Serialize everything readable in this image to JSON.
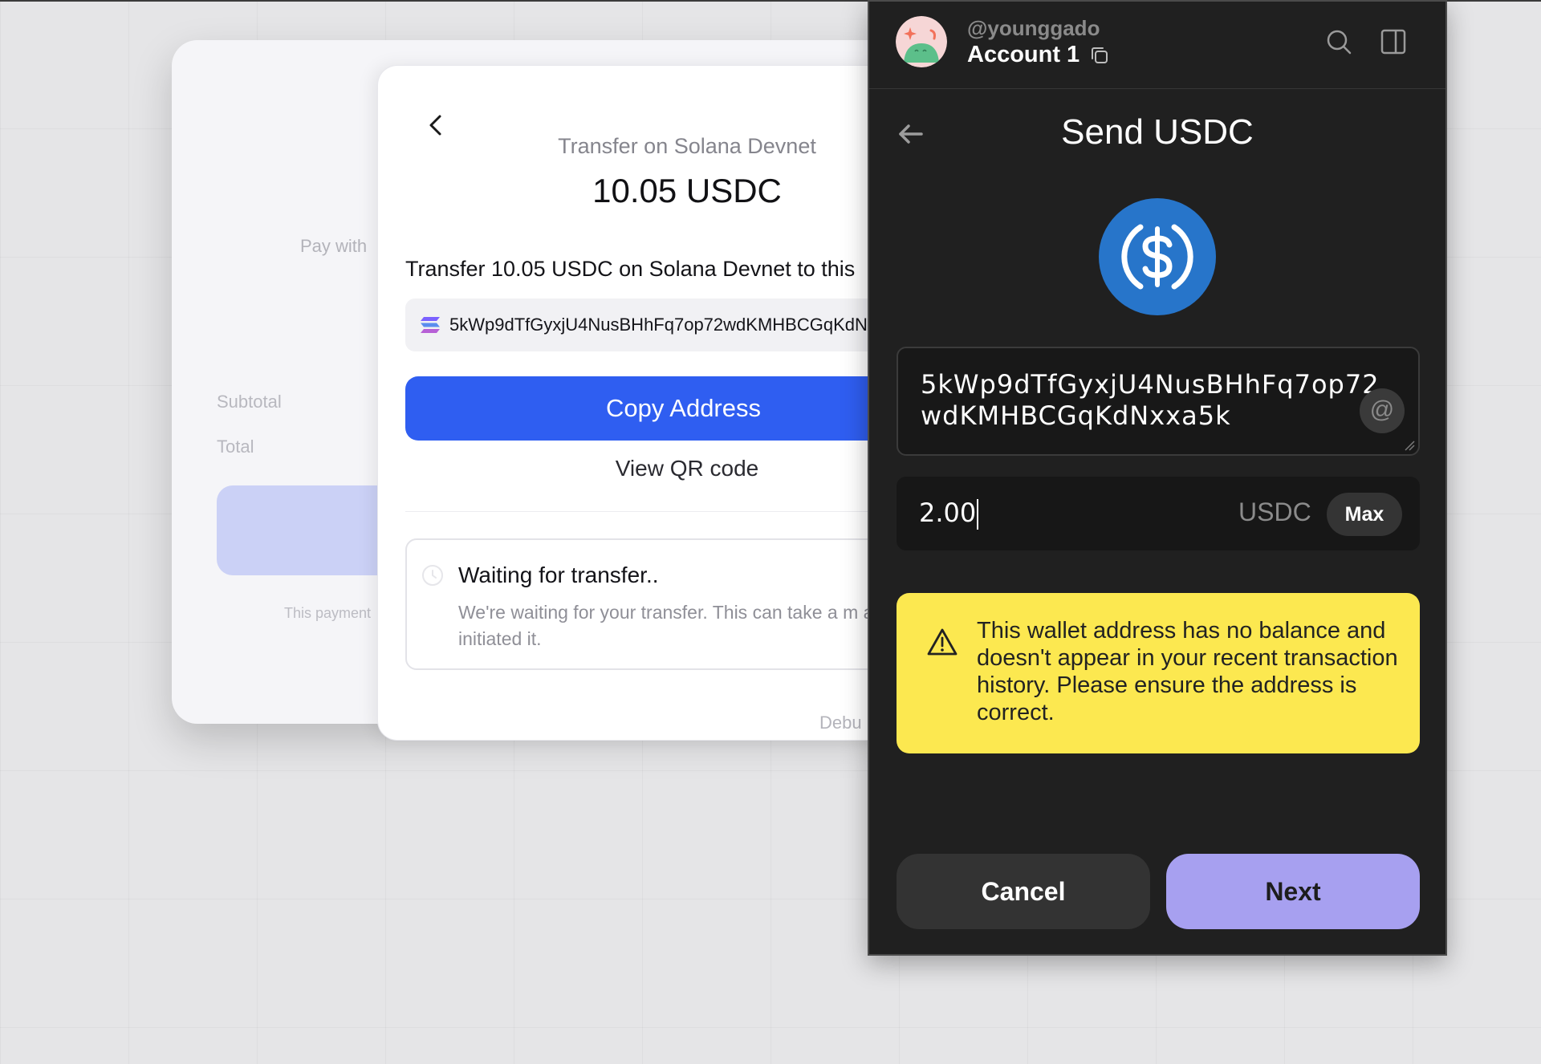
{
  "checkout": {
    "pay_with_label": "Pay with",
    "subtotal_label": "Subtotal",
    "total_label": "Total",
    "footnote": "This payment"
  },
  "transfer_modal": {
    "network_title": "Transfer on Solana Devnet",
    "amount": "10.05 USDC",
    "instruction": "Transfer 10.05 USDC on Solana Devnet to this",
    "address": "5kWp9dTfGyxjU4NusBHhFq7op72wdKMHBCGqKdN",
    "copy_button_label": "Copy Address",
    "qr_link_label": "View QR code",
    "waiting_title": "Waiting for transfer..",
    "waiting_description": "We're waiting for your transfer. This can take a m after you have initiated it.",
    "debug_label": "Debu"
  },
  "wallet": {
    "username": "@younggado",
    "account_name": "Account 1",
    "title": "Send USDC",
    "token_icon": "usdc-icon",
    "recipient_address": "5kWp9dTfGyxjU4NusBHhFq7op72wdKMHBCGqKdNxxa5k",
    "amount_value": "2.00",
    "currency": "USDC",
    "max_label": "Max",
    "warning_text": "This wallet address has no balance and doesn't appear in your recent transaction history. Please ensure the address is correct.",
    "cancel_label": "Cancel",
    "next_label": "Next",
    "colors": {
      "panel_bg": "#202020",
      "warning_bg": "#fce850",
      "next_button_bg": "#a7a0f0",
      "usdc_blue": "#2775ca",
      "copy_button_bg": "#2f5ef1"
    }
  }
}
